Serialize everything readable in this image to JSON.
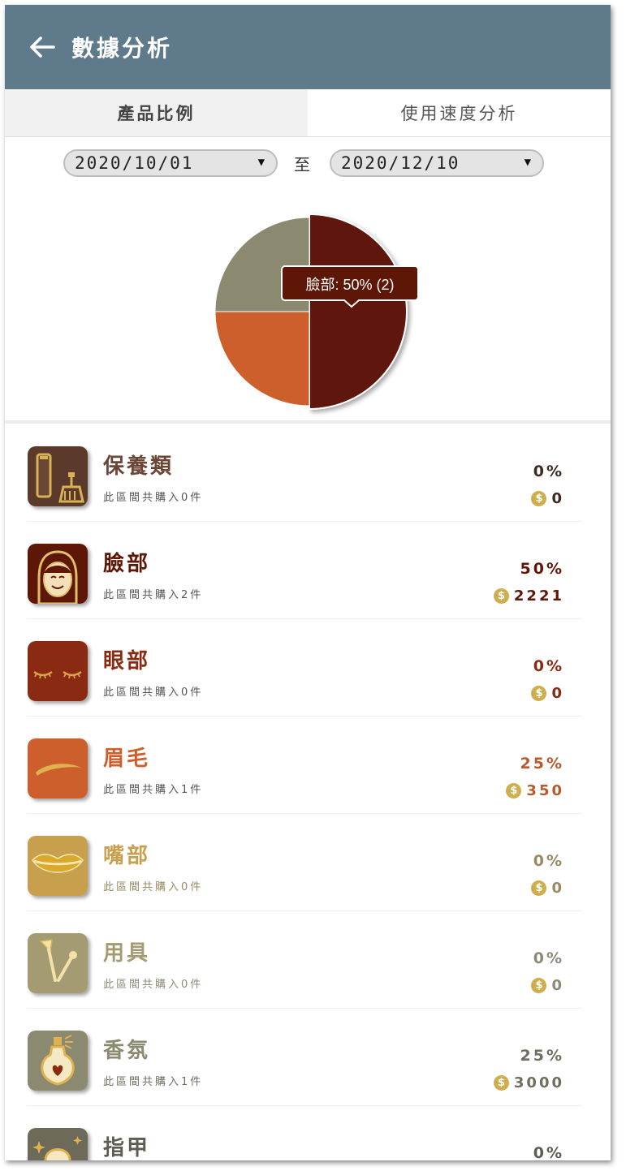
{
  "header": {
    "title": "數據分析"
  },
  "tabs": [
    {
      "label": "產品比例"
    },
    {
      "label": "使用速度分析"
    }
  ],
  "date_range": {
    "start": "2020/10/01",
    "separator": "至",
    "end": "2020/12/10"
  },
  "chart_data": {
    "type": "pie",
    "slices": [
      {
        "label": "臉部",
        "percent": 50,
        "count": 2,
        "color": "#5e1707"
      },
      {
        "label": "眉毛",
        "percent": 25,
        "count": 1,
        "color": "#cc5f2b"
      },
      {
        "label": "香氛",
        "percent": 25,
        "count": 1,
        "color": "#8b8970"
      }
    ],
    "tooltip": "臉部: 50% (2)"
  },
  "categories": [
    {
      "name": "保養類",
      "summary": "此區間共購入0件",
      "percent": "0%",
      "amount": "0",
      "color": "#6b4637",
      "pct_color": "#3a2a22",
      "icon": "skincare-icon"
    },
    {
      "name": "臉部",
      "summary": "此區間共購入2件",
      "percent": "50%",
      "amount": "2221",
      "color": "#5e1707",
      "pct_color": "#5e1707",
      "icon": "face-icon"
    },
    {
      "name": "眼部",
      "summary": "此區間共購入0件",
      "percent": "0%",
      "amount": "0",
      "color": "#8b2a12",
      "pct_color": "#8b2a12",
      "icon": "eye-icon"
    },
    {
      "name": "眉毛",
      "summary": "此區間共購入1件",
      "percent": "25%",
      "amount": "350",
      "color": "#cc5f2b",
      "pct_color": "#b85a2e",
      "icon": "eyebrow-icon"
    },
    {
      "name": "嘴部",
      "summary": "此區間共購入0件",
      "percent": "0%",
      "amount": "0",
      "color": "#c8a04d",
      "pct_color": "#9a8a64",
      "icon": "lips-icon"
    },
    {
      "name": "用具",
      "summary": "此區間共購入0件",
      "percent": "0%",
      "amount": "0",
      "color": "#a59b73",
      "pct_color": "#8d8a78",
      "icon": "brush-icon"
    },
    {
      "name": "香氛",
      "summary": "此區間共購入1件",
      "percent": "25%",
      "amount": "3000",
      "color": "#8b8970",
      "pct_color": "#6f6e60",
      "icon": "perfume-icon"
    },
    {
      "name": "指甲",
      "summary": "",
      "percent": "0%",
      "amount": "",
      "color": "#6d6a59",
      "pct_color": "#5f5d52",
      "icon": "nail-icon"
    }
  ],
  "currency_symbol": "$"
}
